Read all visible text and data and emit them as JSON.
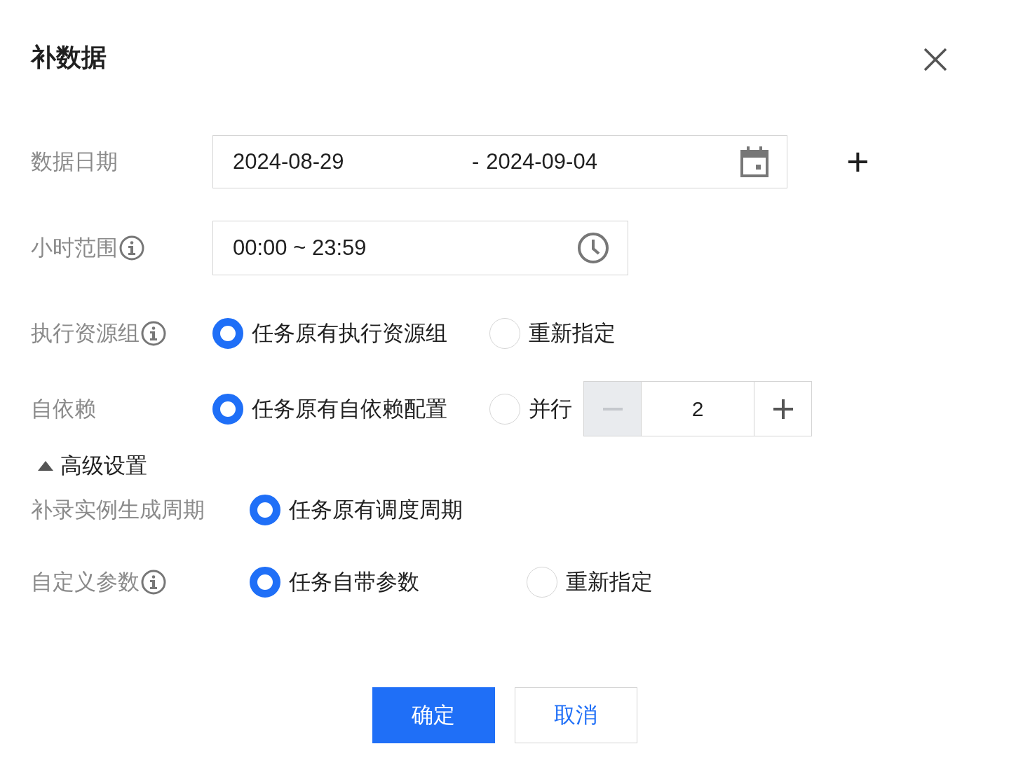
{
  "dialog": {
    "title": "补数据"
  },
  "fields": [
    {
      "kind": "date-range",
      "label": "数据日期",
      "info": false,
      "start": "2024-08-29",
      "separator": "-",
      "end": "2024-09-04",
      "add": "+"
    },
    {
      "kind": "time-range",
      "label": "小时范围",
      "info": true,
      "value": "00:00 ~ 23:59"
    },
    {
      "kind": "radio",
      "label": "执行资源组",
      "info": true,
      "options": [
        {
          "label": "任务原有执行资源组",
          "selected": true
        },
        {
          "label": "重新指定",
          "selected": false
        }
      ]
    },
    {
      "kind": "radio",
      "label": "自依赖",
      "info": false,
      "options": [
        {
          "label": "任务原有自依赖配置",
          "selected": true
        },
        {
          "label": "并行",
          "selected": false
        }
      ],
      "stepper": {
        "value": "2",
        "minus_disabled": true
      }
    }
  ],
  "advanced": {
    "label": "高级设置",
    "expanded": true,
    "fields": [
      {
        "kind": "radio",
        "label": "补录实例生成周期",
        "info": false,
        "options": [
          {
            "label": "任务原有调度周期",
            "selected": true
          }
        ]
      },
      {
        "kind": "radio",
        "label": "自定义参数",
        "info": true,
        "options": [
          {
            "label": "任务自带参数",
            "selected": true
          },
          {
            "label": "重新指定",
            "selected": false
          }
        ]
      }
    ]
  },
  "buttons": [
    {
      "label": "确定",
      "kind": "primary"
    },
    {
      "label": "取消",
      "kind": "secondary"
    }
  ]
}
